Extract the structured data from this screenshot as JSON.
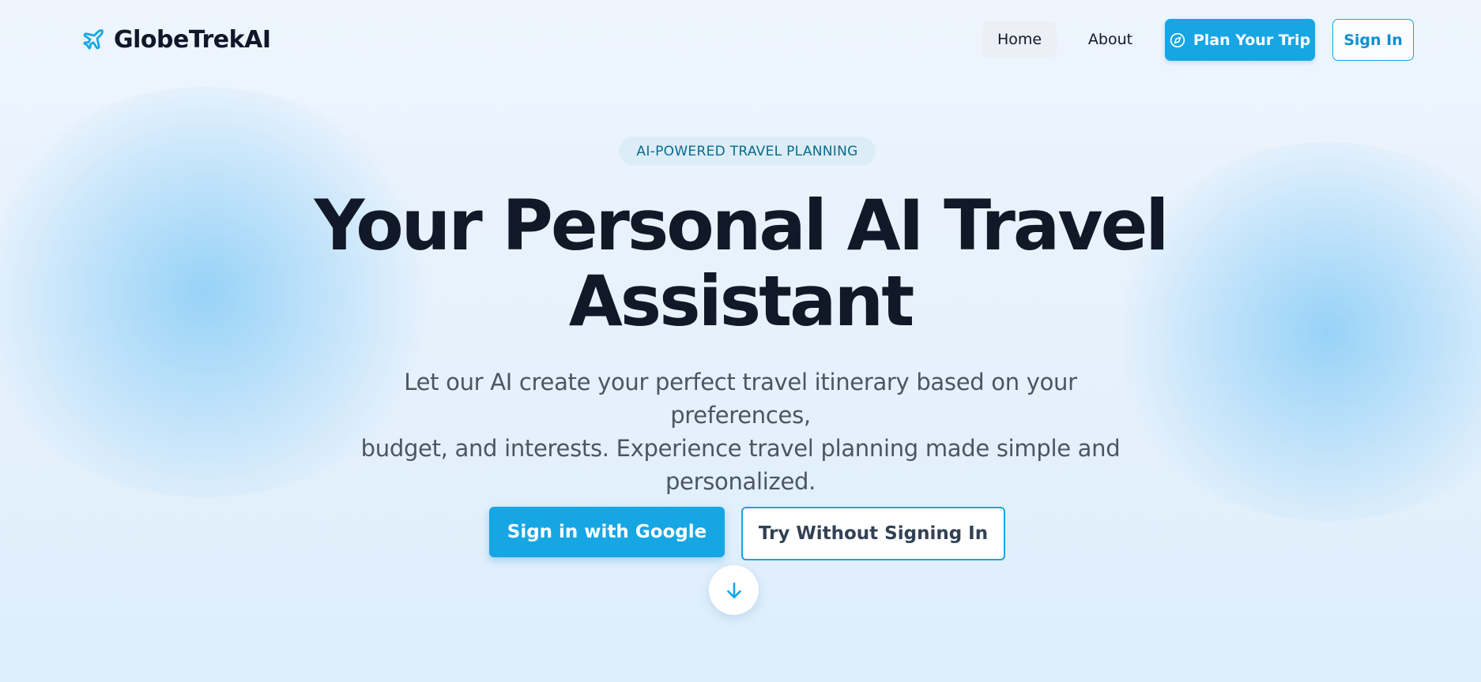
{
  "brand": {
    "name": "GlobeTrekAI",
    "icon": "airplane-icon"
  },
  "nav": {
    "home": "Home",
    "about": "About",
    "plan_trip": "Plan Your Trip",
    "plan_trip_icon": "compass-icon",
    "sign_in": "Sign In"
  },
  "hero": {
    "badge": "AI-POWERED TRAVEL PLANNING",
    "headline_line1": "Your Personal AI Travel",
    "headline_line2": "Assistant",
    "subtitle_line1": "Let our AI create your perfect travel itinerary based on your preferences,",
    "subtitle_line2": "budget, and interests. Experience travel planning made simple and",
    "subtitle_line3": "personalized.",
    "google_button": "Sign in with Google",
    "try_button": "Try Without Signing In",
    "scroll_icon": "arrow-down-icon"
  },
  "colors": {
    "accent": "#16a6e4",
    "heading": "#111827",
    "body_text": "#4b5563",
    "badge_bg": "#dcedf7",
    "badge_text": "#0b6a8e"
  }
}
